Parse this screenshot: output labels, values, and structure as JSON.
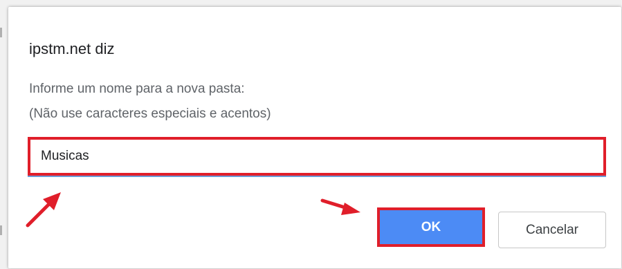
{
  "dialog": {
    "title": "ipstm.net diz",
    "message_line1": "Informe um nome para a nova pasta:",
    "message_line2": "(Não use caracteres especiais e acentos)",
    "input_value": "Musicas",
    "ok_label": "OK",
    "cancel_label": "Cancelar"
  },
  "colors": {
    "highlight": "#e01e2a",
    "ok_button": "#4c8bf5",
    "arrow": "#e01e2a"
  }
}
